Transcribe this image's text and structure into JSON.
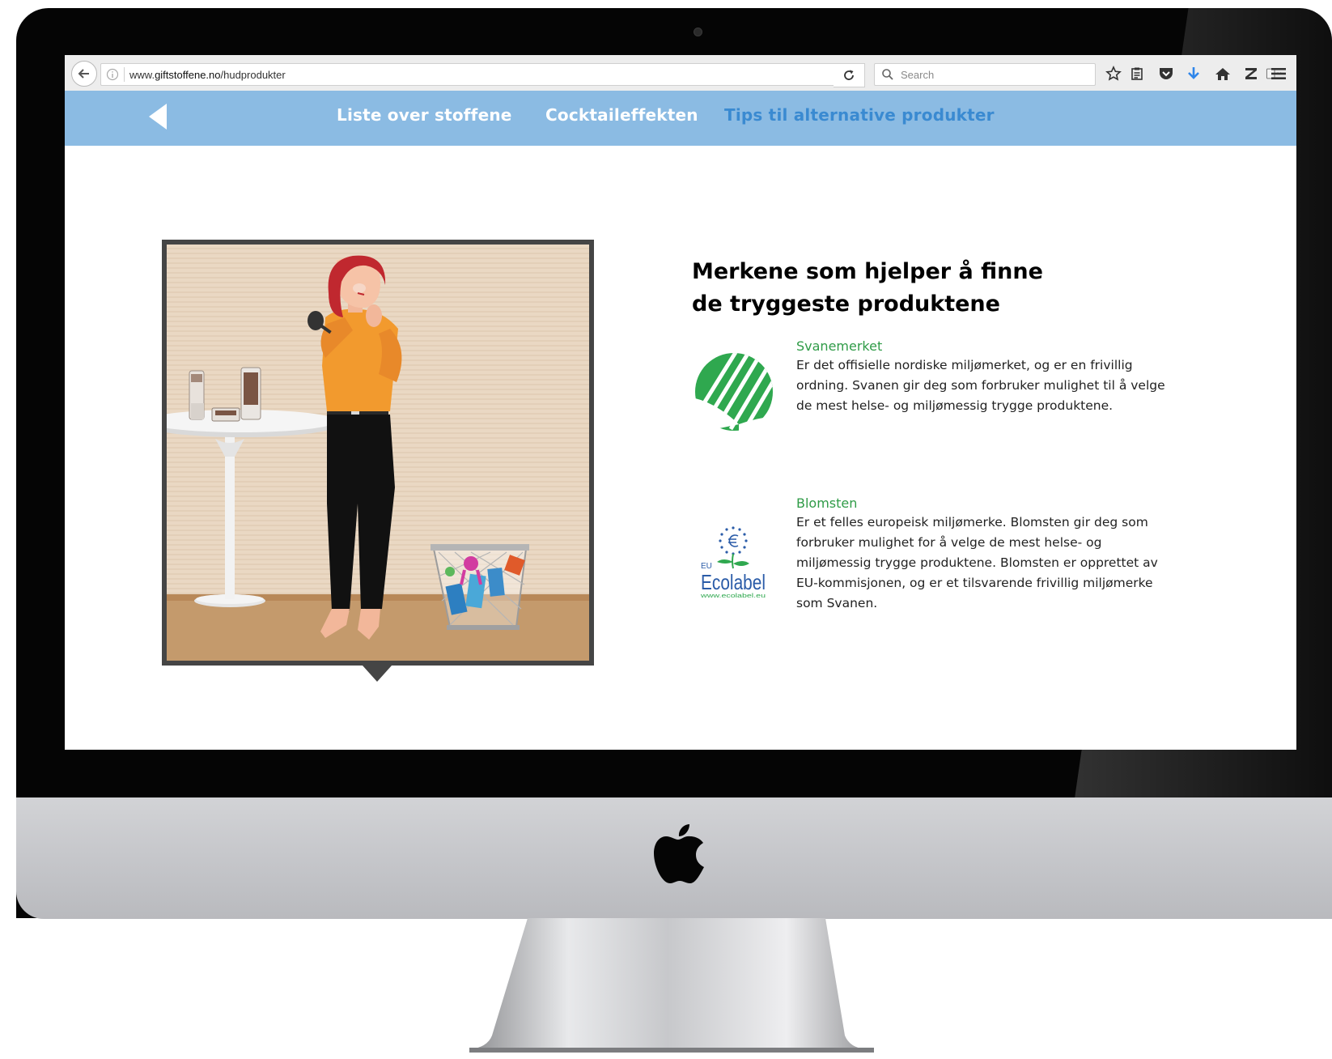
{
  "browser": {
    "url_prefix": "www.",
    "url_domain": "giftstoffene.no",
    "url_path": "/hudprodukter",
    "search_placeholder": "Search"
  },
  "nav": {
    "items": [
      {
        "label": "Liste over stoffene",
        "active": false
      },
      {
        "label": "Cocktaileffekten",
        "active": false
      },
      {
        "label": "Tips til alternative produkter",
        "active": true
      }
    ]
  },
  "content": {
    "headline_line1": "Merkene som hjelper å finne",
    "headline_line2": "de tryggeste produktene",
    "labels": [
      {
        "title": "Svanemerket",
        "text": "Er det offisielle nordiske miljømerket, og er en frivillig ordning. Svanen gir deg som forbruker mulighet til å velge de mest helse- og miljømessig trygge produktene."
      },
      {
        "title": "Blomsten",
        "text": "Er et felles europeisk miljømerke. Blomsten gir deg som forbruker mulighet for å velge de mest helse- og miljømessig trygge produktene. Blomsten er opprettet av EU-kommisjonen, og er et tilsvarende frivillig miljømerke som Svanen."
      }
    ],
    "ecolabel": {
      "eu": "EU",
      "word": "Ecolabel",
      "site": "www.ecolabel.eu"
    }
  },
  "colors": {
    "nav_bg": "#8bbbe3",
    "nav_active": "#3a8ad1",
    "label_title": "#2f9b47",
    "swan_green": "#2fa84f"
  }
}
